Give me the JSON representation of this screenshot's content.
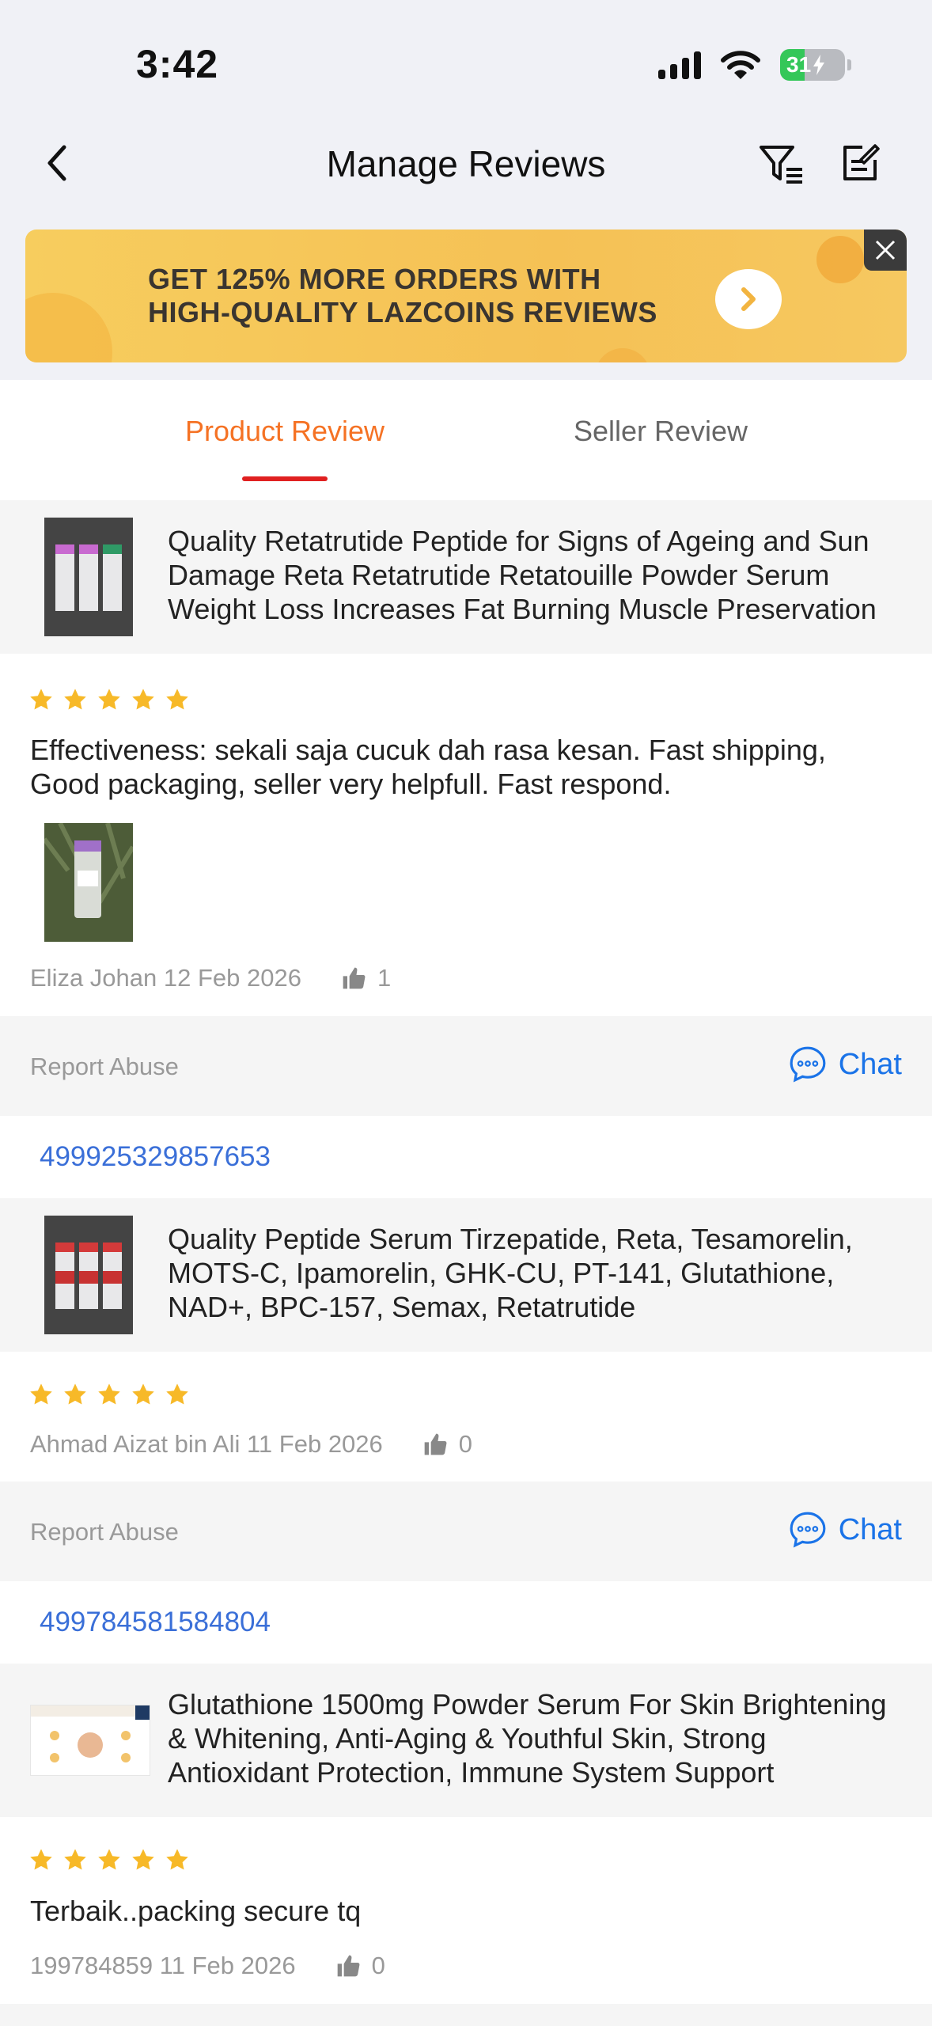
{
  "status_bar": {
    "time": "3:42",
    "battery": "31"
  },
  "header": {
    "title": "Manage Reviews"
  },
  "banner": {
    "text": "GET 125% MORE ORDERS WITH\nHIGH-QUALITY LAZCOINS REVIEWS"
  },
  "tabs": [
    {
      "label": "Product Review",
      "active": true
    },
    {
      "label": "Seller Review",
      "active": false
    }
  ],
  "colors": {
    "accent": "#f57224",
    "link": "#1a73e8",
    "star": "#f7b928",
    "tab_indicator": "#e02020"
  },
  "reviews": [
    {
      "product_title": "Quality Retatrutide Peptide for Signs of Ageing and Sun Damage Reta Retatrutide Retatouille Powder Serum Weight Loss Increases Fat Burning Muscle Preservation",
      "rating": 5,
      "text": "Effectiveness:  sekali saja cucuk dah rasa kesan. Fast shipping, Good packaging, seller very helpfull. Fast respond.",
      "reviewer": "Eliza Johan 12 Feb 2026",
      "likes": "1",
      "report_label": "Report Abuse",
      "chat_label": "Chat"
    },
    {
      "order_id": "499925329857653",
      "product_title": "Quality Peptide Serum Tirzepatide, Reta, Tesamorelin, MOTS-C, Ipamorelin, GHK-CU, PT-141, Glutathione, NAD+, BPC-157, Semax, Retatrutide",
      "rating": 5,
      "reviewer": "Ahmad Aizat bin Ali 11 Feb 2026",
      "likes": "0",
      "report_label": "Report Abuse",
      "chat_label": "Chat"
    },
    {
      "order_id": "499784581584804",
      "product_title": "Glutathione 1500mg Powder Serum For Skin Brightening & Whitening, Anti-Aging & Youthful Skin, Strong Antioxidant Protection, Immune System Support",
      "rating": 5,
      "text": "Terbaik..packing secure tq",
      "reviewer": "199784859 11 Feb 2026",
      "likes": "0"
    }
  ]
}
